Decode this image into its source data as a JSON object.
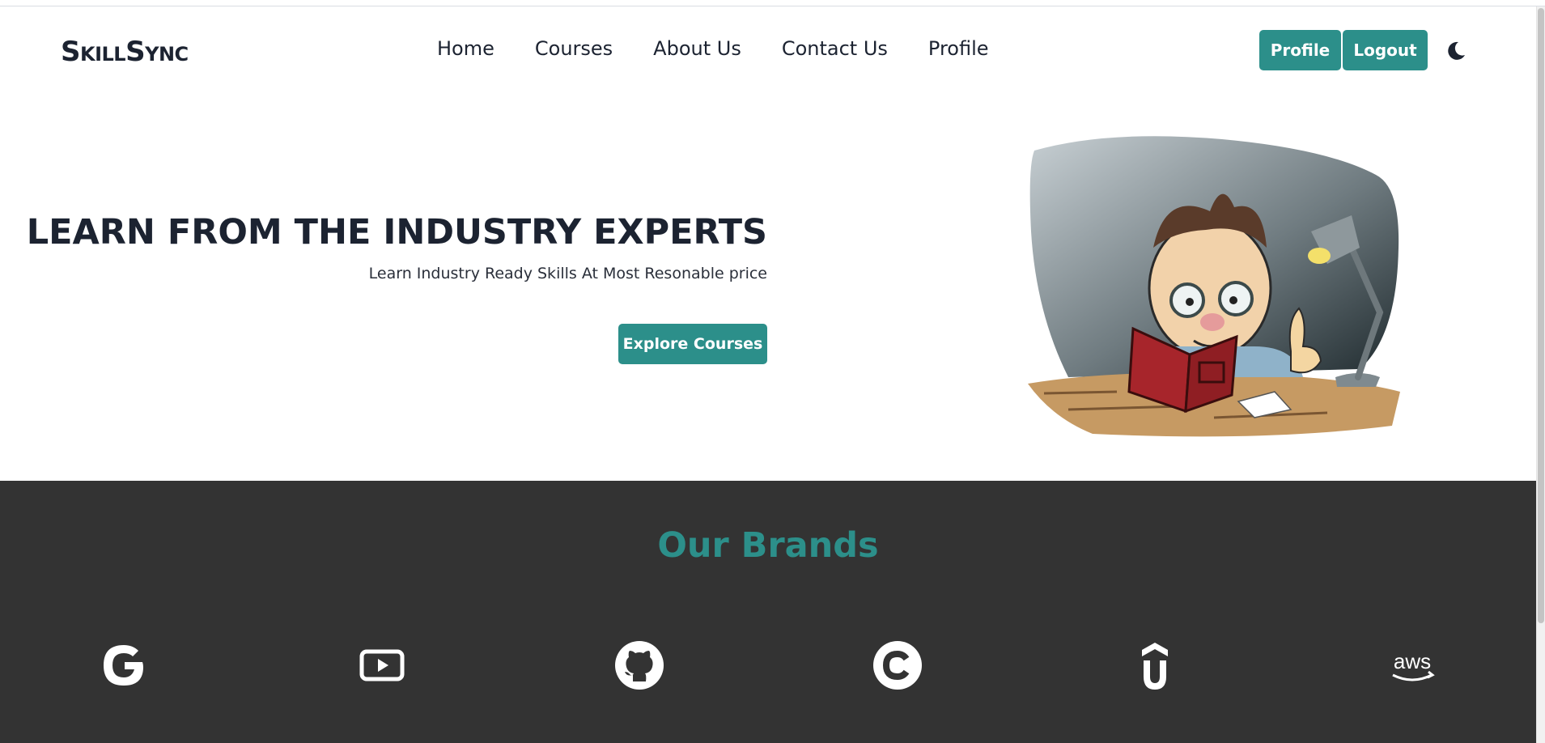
{
  "navbar": {
    "brand": "SkillSync",
    "links": [
      "Home",
      "Courses",
      "About Us",
      "Contact Us",
      "Profile"
    ],
    "profile_button": "Profile",
    "logout_button": "Logout",
    "theme_icon": "moon-icon"
  },
  "hero": {
    "title": "LEARN FROM THE INDUSTRY EXPERTS",
    "subtitle": "Learn Industry Ready Skills At Most Resonable price",
    "cta": "Explore Courses",
    "illustration": "professor-reading-cartoon"
  },
  "brands": {
    "title": "Our Brands",
    "icons": [
      "google-icon",
      "youtube-icon",
      "github-icon",
      "coursera-icon",
      "udemy-icon",
      "aws-icon"
    ]
  },
  "colors": {
    "accent": "#2c8f8a",
    "dark_section": "#333333",
    "text": "#1c2331"
  }
}
